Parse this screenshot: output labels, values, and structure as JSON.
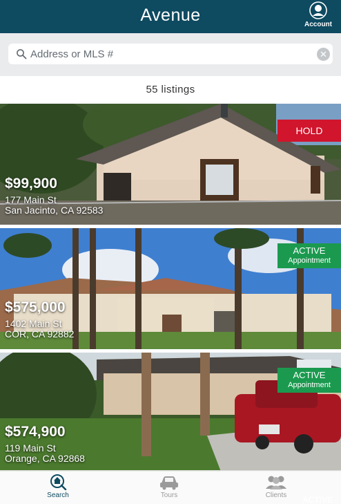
{
  "header": {
    "title": "Avenue",
    "account_label": "Account"
  },
  "search": {
    "placeholder": "Address or MLS #",
    "value": ""
  },
  "results": {
    "count_text": "55 listings"
  },
  "listings": [
    {
      "price": "$99,900",
      "street": "177 Main St",
      "city": "San Jacinto, CA 92583",
      "status": "HOLD",
      "status_sub": ""
    },
    {
      "price": "$575,000",
      "street": "1402 Main St",
      "city": "COR, CA 92882",
      "status": "ACTIVE",
      "status_sub": "Appointment"
    },
    {
      "price": "$574,900",
      "street": "119 Main St",
      "city": "Orange, CA 92868",
      "status": "ACTIVE",
      "status_sub": "Appointment"
    }
  ],
  "peek_status": "ACTIVE",
  "tabs": [
    {
      "label": "Search",
      "icon": "house-search-icon",
      "active": true
    },
    {
      "label": "Tours",
      "icon": "car-icon",
      "active": false
    },
    {
      "label": "Clients",
      "icon": "people-icon",
      "active": false
    }
  ],
  "colors": {
    "header_bg": "#0e4a60",
    "hold": "#d0152c",
    "active": "#1b9a4f",
    "search_bg": "#e9ebec"
  }
}
